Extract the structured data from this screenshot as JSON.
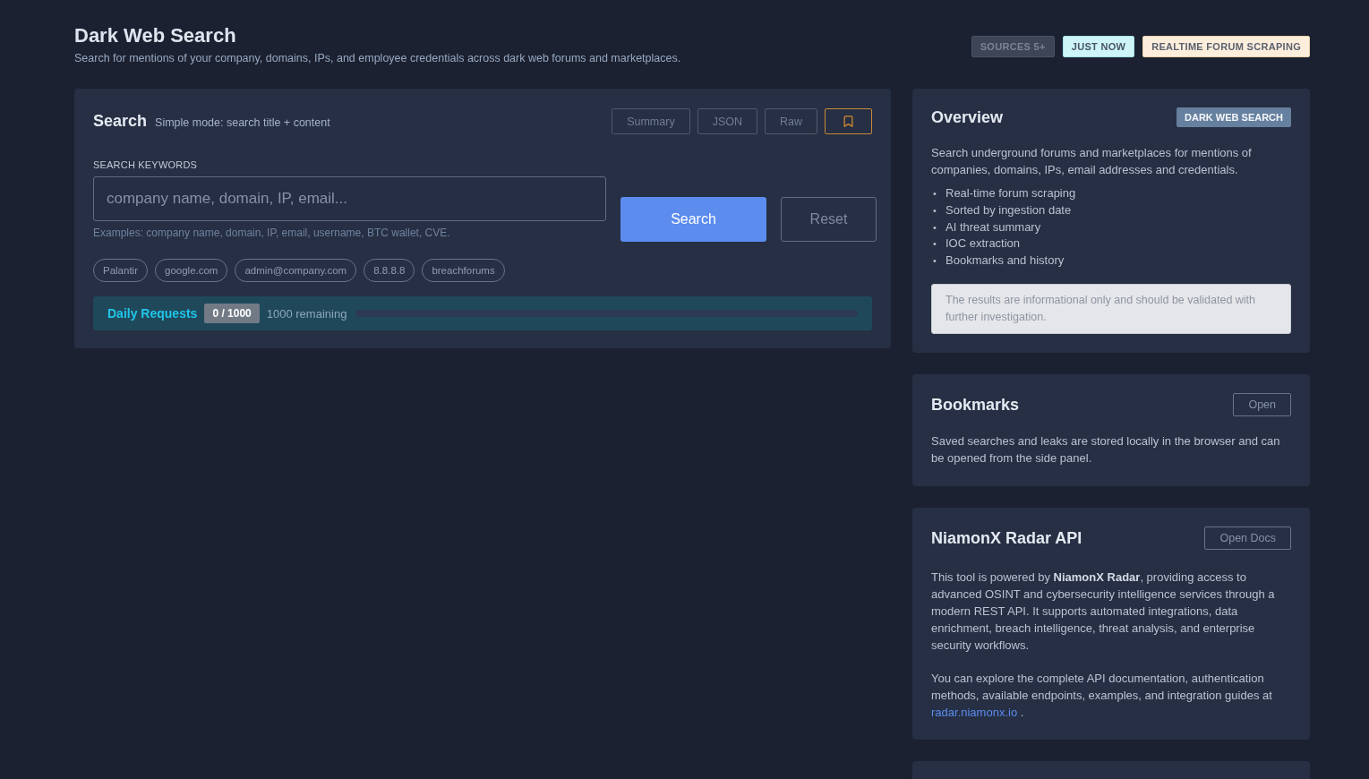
{
  "header": {
    "title": "Dark Web Search",
    "subtitle": "Search for mentions of your company, domains, IPs, and employee credentials across dark web forums and marketplaces.",
    "badges": [
      {
        "label": "SOURCES 5+",
        "kind": "muted"
      },
      {
        "label": "JUST NOW",
        "kind": "info"
      },
      {
        "label": "REALTIME FORUM SCRAPING",
        "kind": "warning"
      }
    ]
  },
  "search_card": {
    "title": "Search",
    "mode": "Simple mode: search title + content",
    "view_buttons": [
      "Summary",
      "JSON",
      "Raw"
    ],
    "field_label": "SEARCH KEYWORDS",
    "placeholder": "company name, domain, IP, email...",
    "hint": "Examples: company name, domain, IP, email, username, BTC wallet, CVE.",
    "search_button": "Search",
    "reset_button": "Reset",
    "chips": [
      "Palantir",
      "google.com",
      "admin@company.com",
      "8.8.8.8",
      "breachforums"
    ],
    "quota": {
      "label": "Daily Requests",
      "count": "0 / 1000",
      "remaining": "1000 remaining",
      "level": 0
    }
  },
  "overview": {
    "title": "Overview",
    "badge": "DARK WEB SEARCH",
    "description": "Search underground forums and marketplaces for mentions of companies, domains, IPs, email addresses and credentials.",
    "features": [
      {
        "marker": "•",
        "text": "Real-time forum scraping"
      },
      {
        "marker": "•",
        "text": "Sorted by ingestion date"
      },
      {
        "marker": "•",
        "text": "AI threat summary"
      },
      {
        "marker": "•",
        "text": "IOC extraction"
      },
      {
        "marker": "•",
        "text": "Bookmarks and history"
      }
    ],
    "disclaimer": "The results are informational only and should be validated with further investigation."
  },
  "bookmarks": {
    "title": "Bookmarks",
    "button": "Open",
    "text": "Saved searches and leaks are stored locally in the browser and can be opened from the side panel."
  },
  "api": {
    "title": "NiamonX Radar API",
    "button": "Open Docs",
    "intro": "This tool is powered by **NiamonX Radar**, providing access to advanced OSINT and cybersecurity intelligence services through a modern REST API. It supports automated integrations, data enrichment, breach intelligence, threat analysis, and enterprise security workflows.",
    "docs_text": "You can explore the complete API documentation, authentication methods, available endpoints, examples, and integration guides at",
    "docs_link": "radar.niamonx.io",
    "docs_after": "."
  }
}
